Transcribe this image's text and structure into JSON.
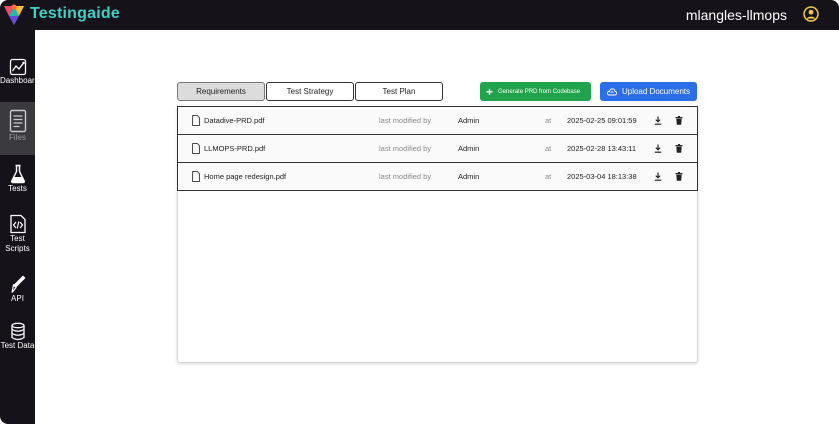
{
  "app": {
    "brand": "Testingaide",
    "user_name": "mlangles-llmops"
  },
  "sidebar": {
    "items": [
      {
        "label": "Dashboard",
        "icon": "dashboard-chart-icon",
        "active": false
      },
      {
        "label": "Files",
        "icon": "files-document-icon",
        "active": true
      },
      {
        "label": "Tests",
        "icon": "flask-icon",
        "active": false
      },
      {
        "label": "Test Scripts",
        "icon": "code-file-icon",
        "active": false
      },
      {
        "label": "API",
        "icon": "pen-nib-icon",
        "active": false
      },
      {
        "label": "Test Data",
        "icon": "database-icon",
        "active": false
      }
    ]
  },
  "tabs": [
    {
      "label": "Requirements",
      "active": true
    },
    {
      "label": "Test Strategy",
      "active": false
    },
    {
      "label": "Test Plan",
      "active": false
    }
  ],
  "actions": {
    "generate_label": "Generate PRD from Codebase",
    "upload_label": "Upload Documents"
  },
  "files": [
    {
      "name": "Datadive-PRD.pdf",
      "modified_label": "last modified by",
      "author": "Admin",
      "at_label": "at",
      "timestamp": "2025-02-25 09:01:59"
    },
    {
      "name": "LLMOPS-PRD.pdf",
      "modified_label": "last modified by",
      "author": "Admin",
      "at_label": "at",
      "timestamp": "2025-02-28 13:43:11"
    },
    {
      "name": "Home page redesign.pdf",
      "modified_label": "last modified by",
      "author": "Admin",
      "at_label": "at",
      "timestamp": "2025-03-04 18:13:38"
    }
  ],
  "colors": {
    "topbar": "#16121a",
    "brand": "#3fd1c4",
    "generate_button": "#20a34a",
    "upload_button": "#2c6ee8",
    "user_icon": "#f2c94c"
  }
}
